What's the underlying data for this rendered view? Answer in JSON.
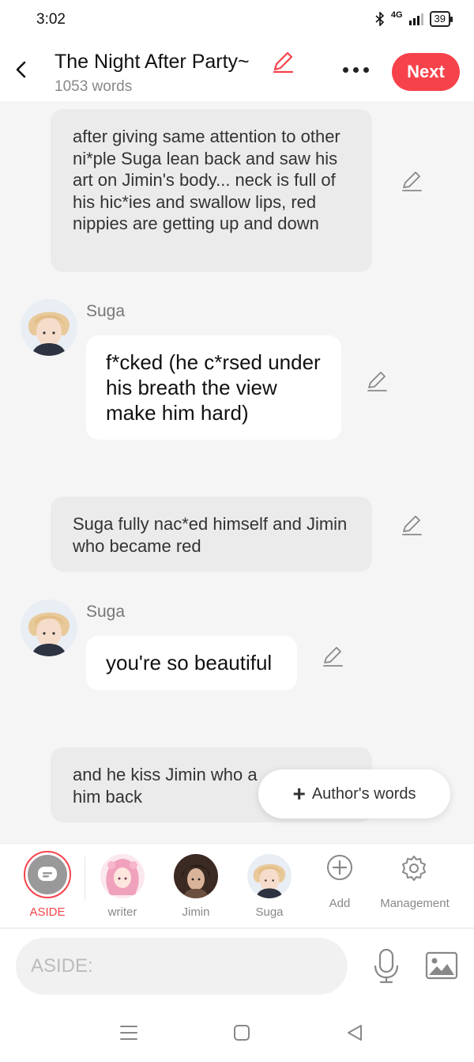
{
  "status": {
    "time": "3:02",
    "network": "4G",
    "battery": "39"
  },
  "header": {
    "title": "The Night After Party~",
    "word_count": "1053 words",
    "next_label": "Next"
  },
  "messages": [
    {
      "type": "aside",
      "text": "after giving same attention to other ni*ple Suga lean back and saw his art on Jimin's body... neck is full of his hic*ies and swallow lips, red nippies are getting up and down"
    },
    {
      "type": "character",
      "speaker": "Suga",
      "text": "f*cked (he c*rsed under his breath the view make him hard)"
    },
    {
      "type": "aside",
      "text": "Suga fully nac*ed himself and Jimin who became red"
    },
    {
      "type": "character",
      "speaker": "Suga",
      "text": "you're so beautiful"
    },
    {
      "type": "aside",
      "text": "and he kiss Jimin who a"
    },
    {
      "type": "aside_line2",
      "text": "him back"
    }
  ],
  "author_words_label": "Author's words",
  "characters": [
    {
      "label": "ASIDE",
      "active": true
    },
    {
      "label": "writer"
    },
    {
      "label": "Jimin"
    },
    {
      "label": "Suga"
    },
    {
      "label": "Add"
    },
    {
      "label": "Management"
    }
  ],
  "input": {
    "placeholder": "ASIDE:"
  },
  "colors": {
    "accent": "#f6434b",
    "aside_bubble": "#ebebeb",
    "background": "#f5f5f5"
  },
  "icons": [
    "back-arrow-icon",
    "pencil-edit-icon",
    "more-icon",
    "chat-bubble-icon",
    "plus-circle-icon",
    "gear-icon",
    "microphone-icon",
    "image-icon",
    "menu-icon",
    "home-icon",
    "back-triangle-icon"
  ]
}
